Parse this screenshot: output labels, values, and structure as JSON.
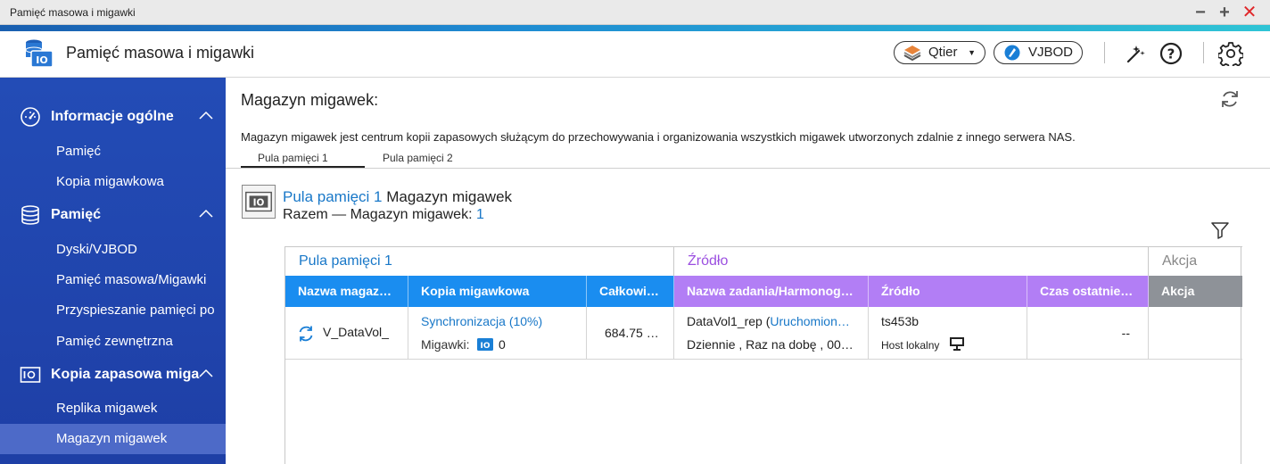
{
  "window": {
    "title": "Pamięć masowa i migawki"
  },
  "app": {
    "name": "Pamięć masowa i migawki",
    "qtier_label": "Qtier",
    "vjbod_label": "VJBOD"
  },
  "sidebar": {
    "sections": [
      {
        "label": "Informacje ogólne",
        "icon": "gauge-icon",
        "items": [
          {
            "label": "Pamięć"
          },
          {
            "label": "Kopia migawkowa"
          }
        ]
      },
      {
        "label": "Pamięć",
        "icon": "database-icon",
        "items": [
          {
            "label": "Dyski/VJBOD"
          },
          {
            "label": "Pamięć masowa/Migawki"
          },
          {
            "label": "Przyspieszanie pamięci po"
          },
          {
            "label": "Pamięć zewnętrzna"
          }
        ]
      },
      {
        "label": "Kopia zapasowa miga",
        "icon": "snapshot-backup-icon",
        "items": [
          {
            "label": "Replika migawek"
          },
          {
            "label": "Magazyn migawek",
            "active": true
          }
        ]
      }
    ]
  },
  "main": {
    "title": "Magazyn migawek:",
    "description": "Magazyn migawek jest centrum kopii zapasowych służącym do przechowywania i organizowania wszystkich migawek utworzonych zdalnie z innego serwera NAS.",
    "tabs": [
      {
        "label": "Pula pamięci  1",
        "active": true
      },
      {
        "label": "Pula pamięci  2"
      }
    ],
    "pool": {
      "name": "Pula pamięci 1",
      "name_suffix": " Magazyn migawek",
      "total_label": "Razem — Magazyn migawek: ",
      "total_value": "1"
    },
    "table": {
      "groups": [
        "Pula pamięci 1",
        "Źródło",
        "Akcja"
      ],
      "headers": [
        "Nazwa magaz…",
        "Kopia migawkowa",
        "Całkowi…",
        "Nazwa zadania/Harmonog…",
        "Źródło",
        "Czas ostatnie…",
        "Akcja"
      ],
      "rows": [
        {
          "name": "V_DataVol_",
          "sync": "Synchronizacja (10%)",
          "snapshots_label": "Migawki: ",
          "snapshots_count": "0",
          "total": "684.75 …",
          "job_name": "DataVol1_rep (",
          "job_status": "Uruchomion…",
          "schedule": "Dziennie , Raz na dobę , 00…",
          "source": "ts453b",
          "source_host": "Host lokalny",
          "last_time": "--",
          "action": ""
        }
      ]
    }
  },
  "colors": {
    "sidebar_bg": "#234cb6",
    "sidebar_active": "#4d6ac8",
    "header_blue": "#1a8df0",
    "header_purple": "#b27ef5",
    "header_gray": "#8e9298",
    "link_blue": "#1978c8",
    "group_purple": "#9b4fe0",
    "close_red": "#e0282b"
  }
}
